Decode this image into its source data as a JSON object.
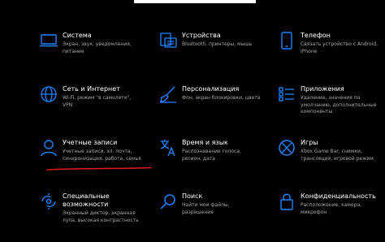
{
  "accent_color": "#1e84ff",
  "annotation_color": "#e01a1a",
  "tiles": [
    {
      "icon": "laptop-icon",
      "title": "Система",
      "desc": [
        "Экран, звук, уведомления,",
        "питание"
      ]
    },
    {
      "icon": "keyboard-printer-icon",
      "title": "Устройства",
      "desc": [
        "Bluetooth, принтеры, мышь"
      ]
    },
    {
      "icon": "phone-icon",
      "title": "Телефон",
      "desc": [
        "Связать устройство с Android,",
        "iPhone"
      ]
    },
    {
      "icon": "globe-icon",
      "title": "Сеть и Интернет",
      "desc": [
        "Wi-Fi, режим \"в самолете\",",
        "VPN"
      ]
    },
    {
      "icon": "paintbrush-icon",
      "title": "Персонализация",
      "desc": [
        "Фон, экран блокировки, цвета"
      ]
    },
    {
      "icon": "apps-list-icon",
      "title": "Приложения",
      "desc": [
        "Удаление, значения по",
        "умолчанию, дополнительные",
        "компоненты"
      ]
    },
    {
      "icon": "person-icon",
      "title": "Учетные записи",
      "desc": [
        "Учетные записи, эл. почта,",
        "синхронизация, работа, семья"
      ]
    },
    {
      "icon": "language-icon",
      "title": "Время и язык",
      "desc": [
        "Распознавание голоса,",
        "регион, дата"
      ]
    },
    {
      "icon": "xbox-icon",
      "title": "Игры",
      "desc": [
        "Xbox Game Bar, снимки,",
        "трансляция, игровой режим"
      ]
    },
    {
      "icon": "ease-of-access-icon",
      "title": "Специальные",
      "title2": "возможности",
      "desc": [
        "Экранный диктор, экранная",
        "лупа, высокая контрастность"
      ]
    },
    {
      "icon": "search-icon",
      "title": "Поиск",
      "desc": [
        "Найти мои файлы,",
        "разрешения"
      ]
    },
    {
      "icon": "lock-icon",
      "title": "Конфиденциальность",
      "desc": [
        "Расположение, камера,",
        "микрофон"
      ]
    }
  ]
}
